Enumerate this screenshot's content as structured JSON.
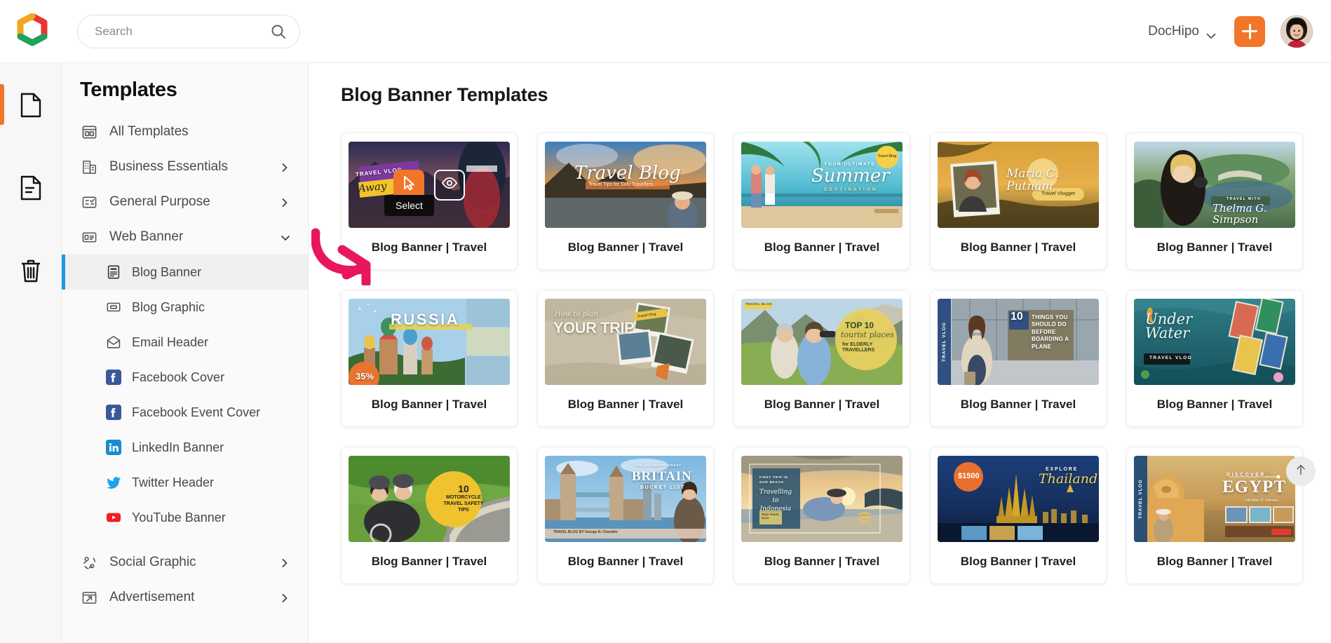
{
  "topbar": {
    "logo_icon": "dochipo-logo-icon",
    "search": {
      "placeholder": "Search",
      "value": "",
      "icon": "search-icon"
    },
    "workspace": {
      "label": "DocHipo",
      "chevron_icon": "chevron-down-icon"
    },
    "create_button": {
      "label": "+",
      "icon": "plus-icon",
      "color": "#f2762a"
    },
    "avatar": {
      "alt": "user-avatar"
    }
  },
  "rail": {
    "items": [
      {
        "icon": "document-icon",
        "name": "documents",
        "active": true
      },
      {
        "icon": "document-text-icon",
        "name": "templates",
        "active": false
      },
      {
        "icon": "trash-icon",
        "name": "trash",
        "active": false
      }
    ],
    "active_color": "#f2762a"
  },
  "sidebar": {
    "title": "Templates",
    "accent_color": "#1c9ae0",
    "items": [
      {
        "label": "All Templates",
        "icon": "grid-layout-icon",
        "expandable": false
      },
      {
        "label": "Business Essentials",
        "icon": "building-icon",
        "expandable": true,
        "chevron": "chevron-right-icon"
      },
      {
        "label": "General Purpose",
        "icon": "checklist-icon",
        "expandable": true,
        "chevron": "chevron-right-icon"
      },
      {
        "label": "Web Banner",
        "icon": "banner-icon",
        "expandable": true,
        "expanded": true,
        "chevron": "chevron-down-icon"
      }
    ],
    "sub_items": [
      {
        "label": "Blog Banner",
        "icon": "blog-banner-icon",
        "selected": true
      },
      {
        "label": "Blog Graphic",
        "icon": "blog-graphic-icon",
        "selected": false
      },
      {
        "label": "Email Header",
        "icon": "envelope-icon",
        "selected": false
      },
      {
        "label": "Facebook Cover",
        "icon": "facebook-icon",
        "selected": false
      },
      {
        "label": "Facebook Event Cover",
        "icon": "facebook-icon",
        "selected": false
      },
      {
        "label": "LinkedIn Banner",
        "icon": "linkedin-icon",
        "selected": false
      },
      {
        "label": "Twitter Header",
        "icon": "twitter-icon",
        "selected": false
      },
      {
        "label": "YouTube Banner",
        "icon": "youtube-icon",
        "selected": false
      }
    ],
    "bottom_items": [
      {
        "label": "Social Graphic",
        "icon": "social-graphic-icon",
        "expandable": true,
        "chevron": "chevron-right-icon"
      },
      {
        "label": "Advertisement",
        "icon": "advertisement-icon",
        "expandable": true,
        "chevron": "chevron-right-icon"
      }
    ]
  },
  "main": {
    "page_title": "Blog Banner Templates",
    "hover_overlay": {
      "select_tooltip": "Select",
      "select_icon": "cursor-pointer-icon",
      "preview_icon": "eye-icon",
      "select_bg": "#f2762a"
    },
    "annotation": {
      "type": "curved-arrow",
      "color": "#e8165c"
    },
    "scroll_top": {
      "icon": "arrow-up-icon",
      "label": ""
    },
    "card_label": "Blog Banner | Travel",
    "templates": [
      {
        "id": 1,
        "label": "Blog Banner | Travel",
        "art": "travel-vlog-away",
        "headline": "TRAVEL VLOG",
        "sub": "Away",
        "hovered": true
      },
      {
        "id": 2,
        "label": "Blog Banner | Travel",
        "art": "travel-blog-solo",
        "headline": "Travel Blog",
        "sub": "Travel Tips for Solo Travellers"
      },
      {
        "id": 3,
        "label": "Blog Banner | Travel",
        "art": "summer-destination",
        "headline": "Summer",
        "sub": "YOUR ULTIMATE",
        "sub2": "DESTINATION",
        "badge": "Travel Blog"
      },
      {
        "id": 4,
        "label": "Blog Banner | Travel",
        "art": "maria-putnam-vlogger",
        "headline": "Maria C. Putnam",
        "sub": "Travel Vlogger"
      },
      {
        "id": 5,
        "label": "Blog Banner | Travel",
        "art": "thelma-simpson",
        "headline": "Thelma G. Simpson",
        "sub": "TRAVEL WITH"
      },
      {
        "id": 6,
        "label": "Blog Banner | Travel",
        "art": "russia",
        "headline": "RUSSIA",
        "badge": "35%"
      },
      {
        "id": 7,
        "label": "Blog Banner | Travel",
        "art": "your-trip",
        "headline": "YOUR TRIP",
        "sub": "How to plan",
        "badge": "Travel Vlog"
      },
      {
        "id": 8,
        "label": "Blog Banner | Travel",
        "art": "elderly-travellers",
        "headline": "TOP 10",
        "sub": "tourist places",
        "sub2": "for ELDERLY TRAVELLERS",
        "badge": "TRAVEL BLOG"
      },
      {
        "id": 9,
        "label": "Blog Banner | Travel",
        "art": "boarding-a-plane",
        "headline": "10",
        "sub": "THINGS YOU SHOULD DO BEFORE BOARDING A PLANE",
        "sidetab": "TRAVEL VLOG"
      },
      {
        "id": 10,
        "label": "Blog Banner | Travel",
        "art": "under-water",
        "headline": "Under Water",
        "badge": "TRAVEL VLOG"
      },
      {
        "id": 11,
        "label": "Blog Banner | Travel",
        "art": "motorcycle-safety",
        "headline": "10",
        "sub": "MOTORCYCLE TRAVEL SAFETY TIPS"
      },
      {
        "id": 12,
        "label": "Blog Banner | Travel",
        "art": "britain-bucket-list",
        "headline": "BRITAIN",
        "sub": "THE ULTIMATE GREAT",
        "sub2": "BUCKET LIST",
        "footer": "TRAVEL BLOG BY George R. Chandler"
      },
      {
        "id": 13,
        "label": "Blog Banner | Travel",
        "art": "travelling-indonesia",
        "headline": "Travelling to Indonesia",
        "sub": "FIRST TRIP IN OUR BEACH",
        "badge": "READ TRAVEL BLOG"
      },
      {
        "id": 14,
        "label": "Blog Banner | Travel",
        "art": "explore-thailand",
        "headline": "Thailand!",
        "sub": "EXPLORE",
        "badge": "$1500"
      },
      {
        "id": 15,
        "label": "Blog Banner | Travel",
        "art": "discover-egypt",
        "headline": "EGYPT",
        "sub": "DISCOVER",
        "sub2": "with Marc D. Johnson",
        "sidetab": "TRAVEL VLOG"
      }
    ]
  }
}
